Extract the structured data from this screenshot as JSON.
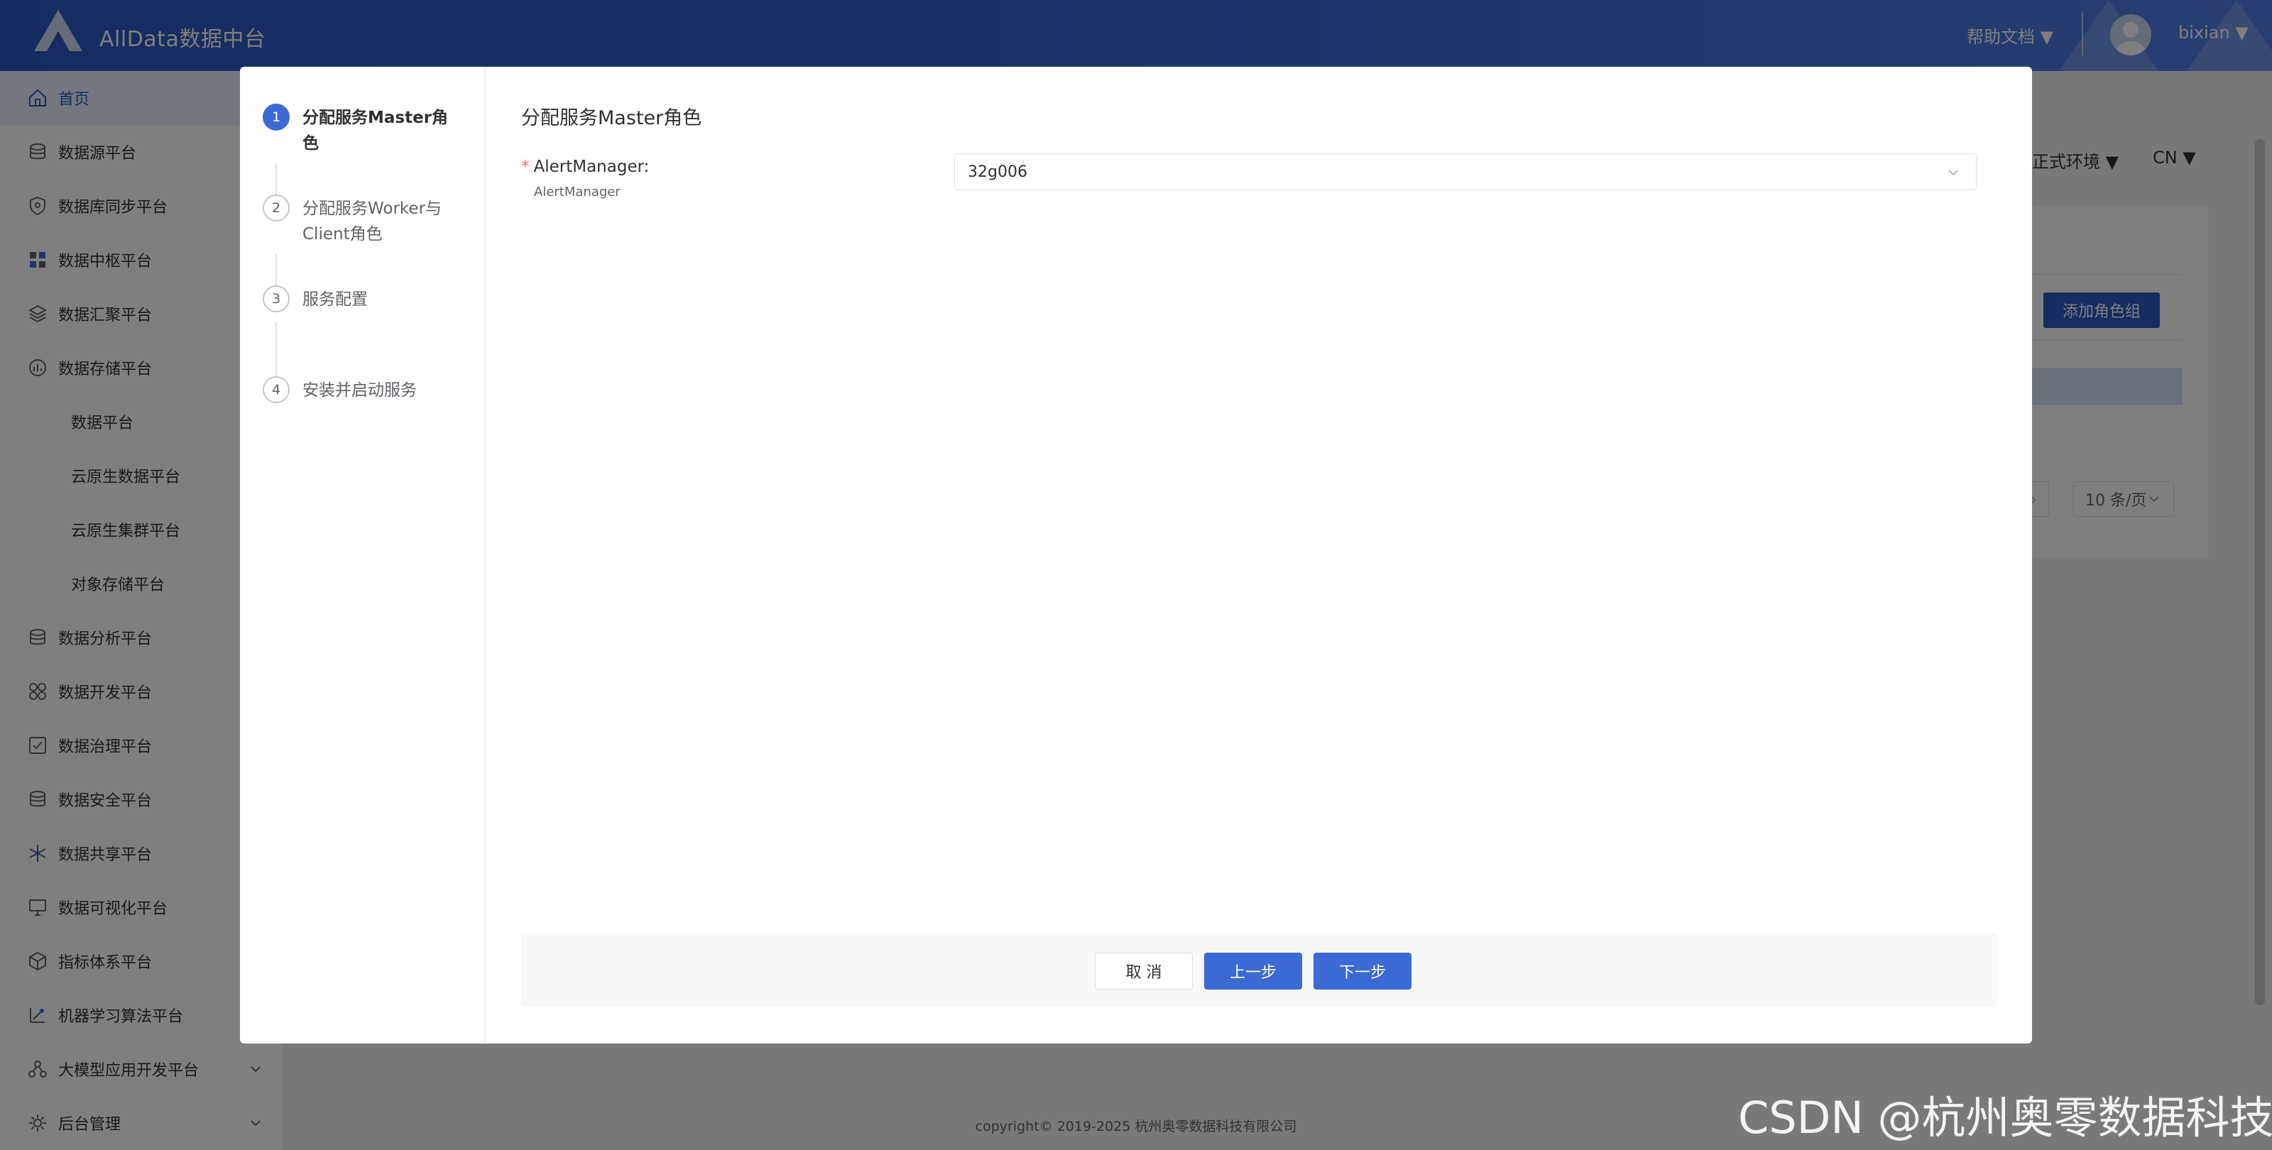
{
  "header": {
    "brand": "AllData数据中台",
    "help_label": "帮助文档 ▼",
    "username": "bixian ▼"
  },
  "sidebar": {
    "items": [
      {
        "label": "首页",
        "icon": "home-icon",
        "active": true
      },
      {
        "label": "数据源平台",
        "icon": "database-icon"
      },
      {
        "label": "数据库同步平台",
        "icon": "shield-icon"
      },
      {
        "label": "数据中枢平台",
        "icon": "grid-icon"
      },
      {
        "label": "数据汇聚平台",
        "icon": "layers-icon"
      },
      {
        "label": "数据存储平台",
        "icon": "chart-circle-icon"
      },
      {
        "label": "数据平台",
        "sub": true
      },
      {
        "label": "云原生数据平台",
        "sub": true
      },
      {
        "label": "云原生集群平台",
        "sub": true
      },
      {
        "label": "对象存储平台",
        "sub": true
      },
      {
        "label": "数据分析平台",
        "icon": "database-icon"
      },
      {
        "label": "数据开发平台",
        "icon": "apps-icon"
      },
      {
        "label": "数据治理平台",
        "icon": "checkbox-icon"
      },
      {
        "label": "数据安全平台",
        "icon": "database-icon"
      },
      {
        "label": "数据共享平台",
        "icon": "snowflake-icon"
      },
      {
        "label": "数据可视化平台",
        "icon": "monitor-icon"
      },
      {
        "label": "指标体系平台",
        "icon": "cube-icon"
      },
      {
        "label": "机器学习算法平台",
        "icon": "ruler-icon"
      },
      {
        "label": "大模型应用开发平台",
        "icon": "network-icon",
        "chevron": true
      },
      {
        "label": "后台管理",
        "icon": "gear-icon",
        "chevron": true
      }
    ]
  },
  "main": {
    "env_label": "正式环境 ▼",
    "lang_label": "CN ▼",
    "add_role_group": "添加角色组",
    "page_size": "10 条/页",
    "copyright": "copyright© 2019-2025 杭州奥零数据科技有限公司"
  },
  "dialog": {
    "steps": [
      {
        "num": "1",
        "label": "分配服务Master角色",
        "active": true
      },
      {
        "num": "2",
        "label": "分配服务Worker与Client角色"
      },
      {
        "num": "3",
        "label": "服务配置"
      },
      {
        "num": "4",
        "label": "安装并启动服务"
      }
    ],
    "content_title": "分配服务Master角色",
    "field": {
      "label": "AlertManager:",
      "sublabel": "AlertManager",
      "value": "32g006"
    },
    "buttons": {
      "cancel": "取 消",
      "prev": "上一步",
      "next": "下一步"
    }
  },
  "watermark": "CSDN @杭州奥零数据科技",
  "colors": {
    "header": "#2a59c0",
    "primary": "#3b6ad4",
    "required": "#f56c6c"
  }
}
